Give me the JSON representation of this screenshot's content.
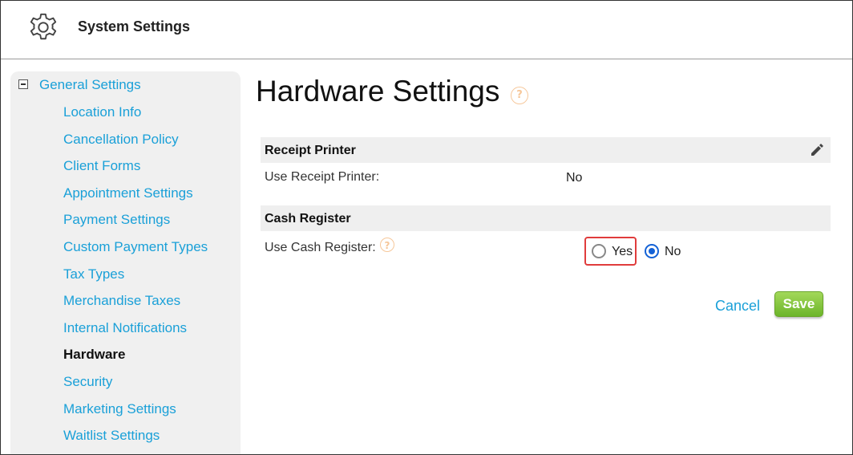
{
  "header": {
    "title": "System Settings",
    "icon": "gear-icon"
  },
  "sidebar": {
    "group": {
      "label": "General Settings",
      "icon": "collapse-minus-icon"
    },
    "items": [
      {
        "label": "Location Info"
      },
      {
        "label": "Cancellation Policy"
      },
      {
        "label": "Client Forms"
      },
      {
        "label": "Appointment Settings"
      },
      {
        "label": "Payment Settings"
      },
      {
        "label": "Custom Payment Types"
      },
      {
        "label": "Tax Types"
      },
      {
        "label": "Merchandise Taxes"
      },
      {
        "label": "Internal Notifications"
      },
      {
        "label": "Hardware",
        "active": true
      },
      {
        "label": "Security"
      },
      {
        "label": "Marketing Settings"
      },
      {
        "label": "Waitlist Settings"
      }
    ]
  },
  "main": {
    "title": "Hardware Settings",
    "help_glyph": "?",
    "sections": {
      "receipt": {
        "title": "Receipt Printer",
        "row_label": "Use Receipt Printer:",
        "row_value": "No"
      },
      "cash": {
        "title": "Cash Register",
        "row_label": "Use Cash Register:",
        "options": {
          "yes": "Yes",
          "no": "No"
        },
        "selected": "No"
      }
    },
    "actions": {
      "cancel": "Cancel",
      "save": "Save"
    }
  },
  "colors": {
    "link": "#1aa0d8",
    "save": "#7cc23a",
    "highlight": "#e03c3c",
    "radio": "#1462d6"
  }
}
